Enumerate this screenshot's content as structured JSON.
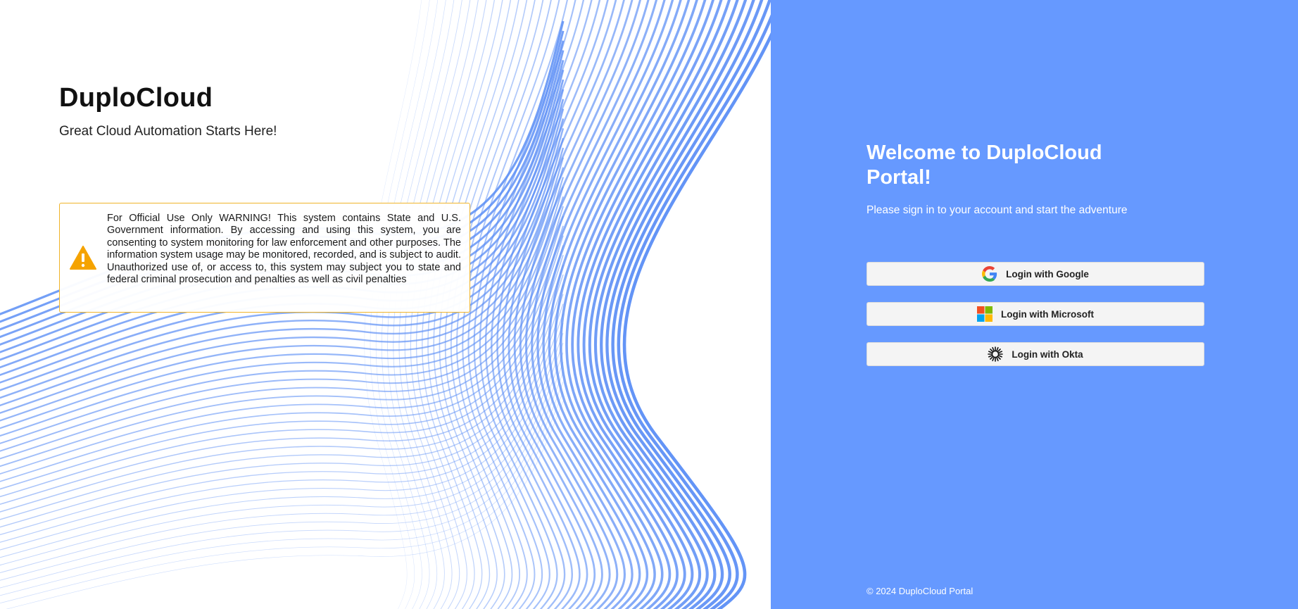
{
  "brand": {
    "name": "DuploCloud",
    "tagline": "Great Cloud Automation Starts Here!"
  },
  "warning": {
    "icon": "warning-triangle-icon",
    "text": "For Official Use Only WARNING! This system contains State and U.S. Government information. By accessing and using this system, you are consenting to system monitoring for law enforcement and other purposes. The information system usage may be monitored, recorded, and is subject to audit. Unauthorized use of, or access to, this system may subject you to state and federal criminal prosecution and penalties as well as civil penalties"
  },
  "login": {
    "welcome": "Welcome to DuploCloud Portal!",
    "subtitle": "Please sign in to your account and start the adventure",
    "google_label": "Login with Google",
    "microsoft_label": "Login with Microsoft",
    "okta_label": "Login with Okta"
  },
  "footer": {
    "copyright": "© 2024 DuploCloud Portal"
  },
  "colors": {
    "accent": "#6699ff",
    "wave": "#5b8ef5",
    "warning_border": "#f0b429",
    "warning_icon": "#f5a300"
  }
}
